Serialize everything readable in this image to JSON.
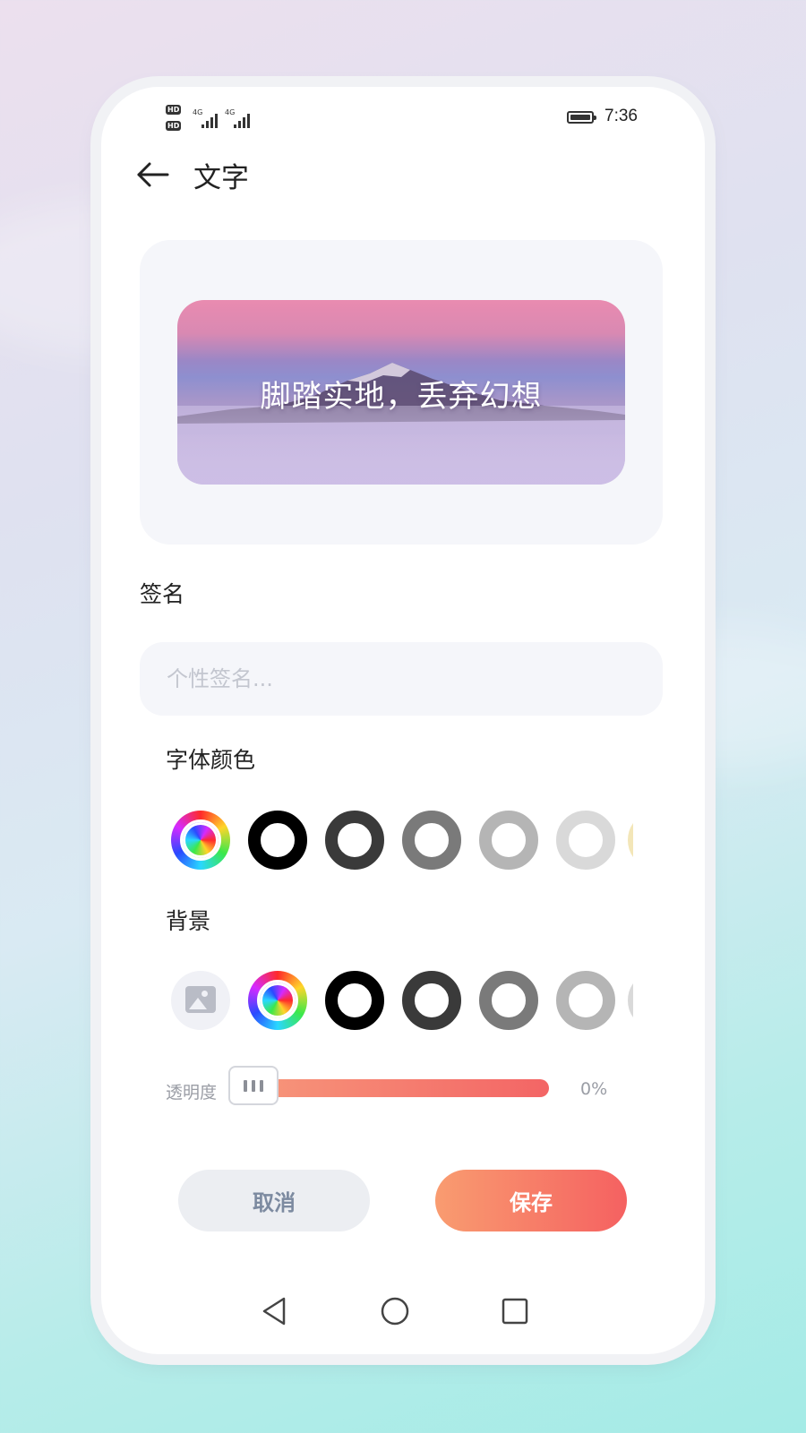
{
  "status_bar": {
    "time": "7:36",
    "hd1": "HD",
    "hd2": "HD",
    "net1": "4G",
    "net2": "4G"
  },
  "header": {
    "title": "文字"
  },
  "preview": {
    "quote": "脚踏实地，丢弃幻想"
  },
  "signature": {
    "label": "签名",
    "placeholder": "个性签名...",
    "value": ""
  },
  "font_color": {
    "label": "字体颜色",
    "swatches": [
      "rainbow",
      "#000000",
      "#3a3a3a",
      "#7a7a7a",
      "#b5b5b5",
      "#d9d9d9"
    ]
  },
  "background": {
    "label": "背景",
    "swatches": [
      "image-icon",
      "rainbow",
      "#000000",
      "#3a3a3a",
      "#7a7a7a",
      "#b5b5b5"
    ]
  },
  "opacity": {
    "label": "透明度",
    "value": "0%"
  },
  "actions": {
    "cancel": "取消",
    "save": "保存"
  },
  "accent_gradient": [
    "#f99c70",
    "#f56161"
  ]
}
